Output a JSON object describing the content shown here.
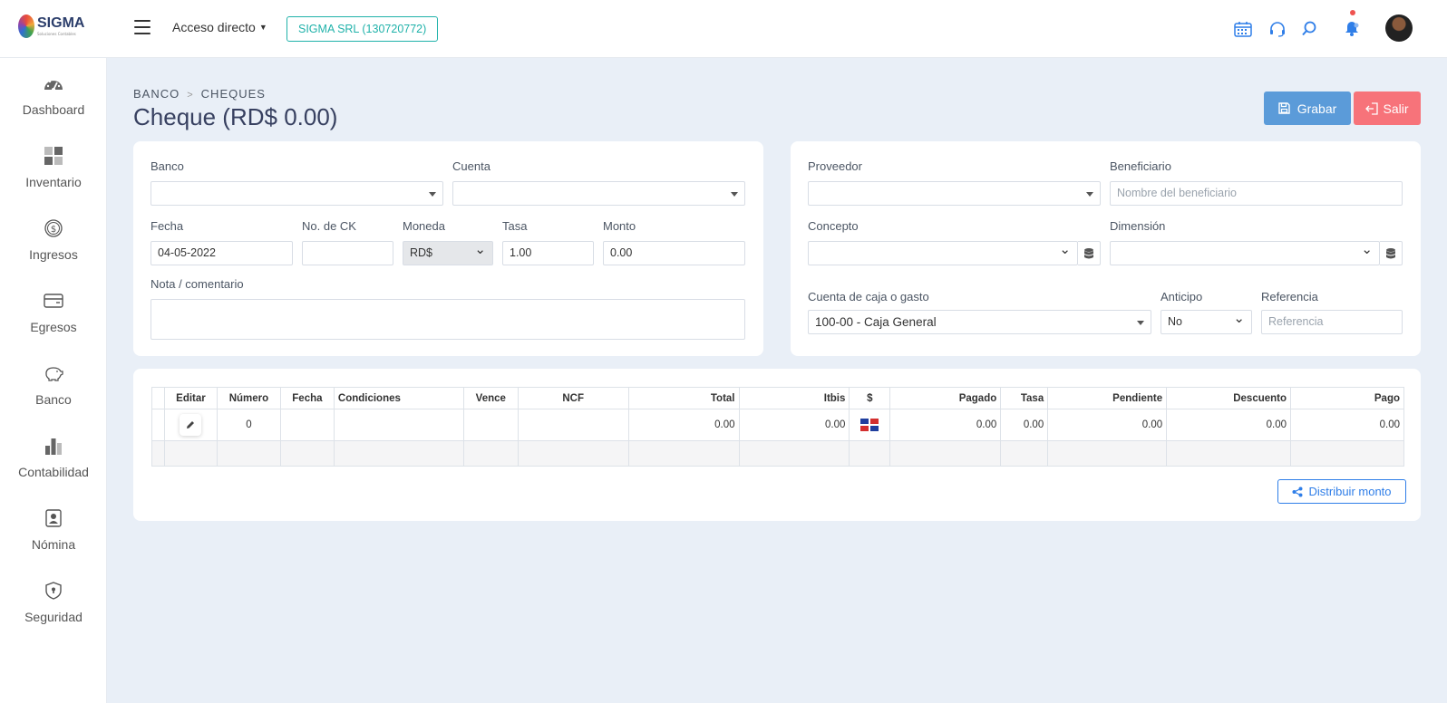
{
  "app": {
    "logo_text": "SIGMA",
    "logo_sub": "Soluciones Contables"
  },
  "topbar": {
    "quick_access": "Acceso directo",
    "company": "SIGMA SRL (130720772)"
  },
  "sidebar": {
    "items": [
      {
        "label": "Dashboard",
        "icon": "gauge-icon"
      },
      {
        "label": "Inventario",
        "icon": "grid-icon"
      },
      {
        "label": "Ingresos",
        "icon": "dollar-circle-icon"
      },
      {
        "label": "Egresos",
        "icon": "card-icon"
      },
      {
        "label": "Banco",
        "icon": "piggy-bank-icon"
      },
      {
        "label": "Contabilidad",
        "icon": "bar-chart-icon"
      },
      {
        "label": "Nómina",
        "icon": "badge-icon"
      },
      {
        "label": "Seguridad",
        "icon": "shield-icon"
      }
    ]
  },
  "breadcrumb": {
    "parent": "BANCO",
    "current": "CHEQUES"
  },
  "page": {
    "title": "Cheque (RD$ 0.00)"
  },
  "actions": {
    "save": "Grabar",
    "exit": "Salir"
  },
  "form_left": {
    "banco_label": "Banco",
    "banco_value": "",
    "cuenta_label": "Cuenta",
    "cuenta_value": "",
    "fecha_label": "Fecha",
    "fecha_value": "04-05-2022",
    "nock_label": "No. de CK",
    "nock_value": "",
    "moneda_label": "Moneda",
    "moneda_value": "RD$",
    "tasa_label": "Tasa",
    "tasa_value": "1.00",
    "monto_label": "Monto",
    "monto_value": "0.00",
    "nota_label": "Nota / comentario",
    "nota_value": ""
  },
  "form_right": {
    "proveedor_label": "Proveedor",
    "proveedor_value": "",
    "beneficiario_label": "Beneficiario",
    "beneficiario_placeholder": "Nombre del beneficiario",
    "concepto_label": "Concepto",
    "concepto_value": "",
    "dimension_label": "Dimensión",
    "dimension_value": "",
    "cuenta_caja_label": "Cuenta de caja o gasto",
    "cuenta_caja_value": "100-00 - Caja General",
    "anticipo_label": "Anticipo",
    "anticipo_value": "No",
    "referencia_label": "Referencia",
    "referencia_placeholder": "Referencia"
  },
  "table": {
    "headers": [
      "Editar",
      "Número",
      "Fecha",
      "Condiciones",
      "Vence",
      "NCF",
      "Total",
      "Itbis",
      "$",
      "Pagado",
      "Tasa",
      "Pendiente",
      "Descuento",
      "Pago"
    ],
    "row": {
      "numero": "0",
      "fecha": "",
      "condiciones": "",
      "vence": "",
      "ncf": "",
      "total": "0.00",
      "itbis": "0.00",
      "pagado": "0.00",
      "tasa": "0.00",
      "pendiente": "0.00",
      "descuento": "0.00",
      "pago": "0.00"
    }
  },
  "distribute_button": "Distribuir monto",
  "colors": {
    "accent": "#2f7ee8",
    "teal": "#20b2aa",
    "save": "#5b9bd9",
    "exit": "#f7737a",
    "background": "#e9eff7"
  }
}
